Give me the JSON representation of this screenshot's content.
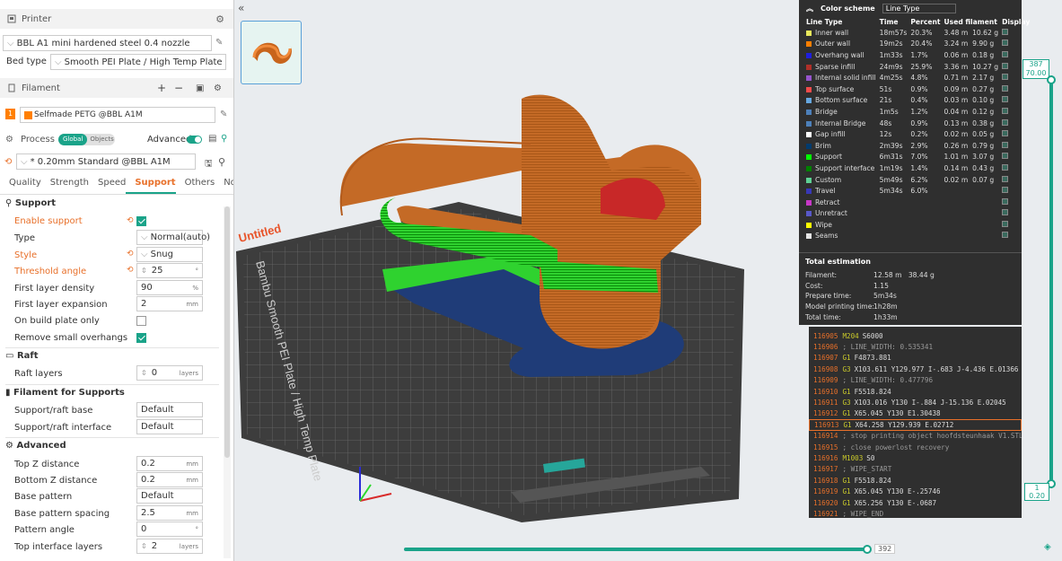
{
  "printer": {
    "header": "Printer",
    "model": "BBL A1 mini hardened steel 0.4 nozzle",
    "bed_label": "Bed type",
    "bed_value": "Smooth PEI Plate / High Temp Plate"
  },
  "filament": {
    "header": "Filament",
    "index": "1",
    "name": "Selfmade PETG @BBL A1M"
  },
  "process": {
    "header": "Process",
    "global_tab": "Global",
    "objects_tab": "Objects",
    "advanced_label": "Advanced",
    "preset": "* 0.20mm Standard @BBL A1M"
  },
  "tabs": [
    "Quality",
    "Strength",
    "Speed",
    "Support",
    "Others",
    "Notes"
  ],
  "support": {
    "group": "Support",
    "enable": "Enable support",
    "type_label": "Type",
    "type_val": "Normal(auto)",
    "style_label": "Style",
    "style_val": "Snug",
    "threshold_label": "Threshold angle",
    "threshold_val": "25",
    "threshold_unit": "°",
    "fld_label": "First layer density",
    "fld_val": "90",
    "fld_unit": "%",
    "fle_label": "First layer expansion",
    "fle_val": "2",
    "fle_unit": "mm",
    "obp_label": "On build plate only",
    "rso_label": "Remove small overhangs"
  },
  "raft": {
    "group": "Raft",
    "layers_label": "Raft layers",
    "layers_val": "0",
    "layers_unit": "layers"
  },
  "fil_support": {
    "group": "Filament for Supports",
    "base_label": "Support/raft base",
    "base_val": "Default",
    "iface_label": "Support/raft interface",
    "iface_val": "Default"
  },
  "advanced": {
    "group": "Advanced",
    "topz_label": "Top Z distance",
    "topz_val": "0.2",
    "botz_label": "Bottom Z distance",
    "botz_val": "0.2",
    "bp_label": "Base pattern",
    "bp_val": "Default",
    "bps_label": "Base pattern spacing",
    "bps_val": "2.5",
    "pa_label": "Pattern angle",
    "pa_val": "0",
    "til_label": "Top interface layers",
    "til_val": "2",
    "mm": "mm",
    "deg": "°",
    "layers": "layers"
  },
  "plate": {
    "name": "Untitled",
    "bed_text": "Bambu Smooth PEI Plate / High Temp Plate"
  },
  "legend": {
    "title": "Color scheme",
    "scheme": "Line Type",
    "cols": [
      "Line Type",
      "Time",
      "Percent",
      "Used filament",
      "Display"
    ],
    "rows": [
      {
        "name": "Inner wall",
        "color": "#e8e85c",
        "time": "18m57s",
        "pct": "20.3%",
        "len": "3.48 m",
        "g": "10.62 g"
      },
      {
        "name": "Outer wall",
        "color": "#ff7f00",
        "time": "19m2s",
        "pct": "20.4%",
        "len": "3.24 m",
        "g": "9.90 g"
      },
      {
        "name": "Overhang wall",
        "color": "#1f1fdf",
        "time": "1m33s",
        "pct": "1.7%",
        "len": "0.06 m",
        "g": "0.18 g"
      },
      {
        "name": "Sparse infill",
        "color": "#b03029",
        "time": "24m9s",
        "pct": "25.9%",
        "len": "3.36 m",
        "g": "10.27 g"
      },
      {
        "name": "Internal solid infill",
        "color": "#9654cc",
        "time": "4m25s",
        "pct": "4.8%",
        "len": "0.71 m",
        "g": "2.17 g"
      },
      {
        "name": "Top surface",
        "color": "#f04b4b",
        "time": "51s",
        "pct": "0.9%",
        "len": "0.09 m",
        "g": "0.27 g"
      },
      {
        "name": "Bottom surface",
        "color": "#66a8e0",
        "time": "21s",
        "pct": "0.4%",
        "len": "0.03 m",
        "g": "0.10 g"
      },
      {
        "name": "Bridge",
        "color": "#4d80ba",
        "time": "1m5s",
        "pct": "1.2%",
        "len": "0.04 m",
        "g": "0.12 g"
      },
      {
        "name": "Internal Bridge",
        "color": "#4d80ba",
        "time": "48s",
        "pct": "0.9%",
        "len": "0.13 m",
        "g": "0.38 g"
      },
      {
        "name": "Gap infill",
        "color": "#ffffff",
        "time": "12s",
        "pct": "0.2%",
        "len": "0.02 m",
        "g": "0.05 g"
      },
      {
        "name": "Brim",
        "color": "#003b6e",
        "time": "2m39s",
        "pct": "2.9%",
        "len": "0.26 m",
        "g": "0.79 g"
      },
      {
        "name": "Support",
        "color": "#00ff00",
        "time": "6m31s",
        "pct": "7.0%",
        "len": "1.01 m",
        "g": "3.07 g"
      },
      {
        "name": "Support interface",
        "color": "#008000",
        "time": "1m19s",
        "pct": "1.4%",
        "len": "0.14 m",
        "g": "0.43 g"
      },
      {
        "name": "Custom",
        "color": "#5ed194",
        "time": "5m49s",
        "pct": "6.2%",
        "len": "0.02 m",
        "g": "0.07 g"
      },
      {
        "name": "Travel",
        "color": "#3838b8",
        "time": "5m34s",
        "pct": "6.0%",
        "len": "",
        "g": ""
      },
      {
        "name": "Retract",
        "color": "#c838c8",
        "time": "",
        "pct": "",
        "len": "",
        "g": ""
      },
      {
        "name": "Unretract",
        "color": "#5858c8",
        "time": "",
        "pct": "",
        "len": "",
        "g": ""
      },
      {
        "name": "Wipe",
        "color": "#ffff00",
        "time": "",
        "pct": "",
        "len": "",
        "g": ""
      },
      {
        "name": "Seams",
        "color": "#e6e6e6",
        "time": "",
        "pct": "",
        "len": "",
        "g": ""
      }
    ],
    "total": {
      "title": "Total estimation",
      "filament_label": "Filament:",
      "filament_len": "12.58 m",
      "filament_g": "38.44 g",
      "cost_label": "Cost:",
      "cost": "1.15",
      "prep_label": "Prepare time:",
      "prep": "5m34s",
      "model_label": "Model printing time:",
      "model": "1h28m",
      "total_label": "Total time:",
      "total": "1h33m"
    }
  },
  "gcode": [
    {
      "n": "116905",
      "c": "M204",
      "a": "S6000"
    },
    {
      "n": "116906",
      "c": "",
      "a": "; LINE_WIDTH: 0.535341"
    },
    {
      "n": "116907",
      "c": "G1",
      "a": "F4873.881"
    },
    {
      "n": "116908",
      "c": "G3",
      "a": "X103.611 Y129.977 I-.683 J-4.436 E.01366"
    },
    {
      "n": "116909",
      "c": "",
      "a": "; LINE_WIDTH: 0.477796"
    },
    {
      "n": "116910",
      "c": "G1",
      "a": "F5518.824"
    },
    {
      "n": "116911",
      "c": "G3",
      "a": "X103.016 Y130 I-.884 J-15.136 E.02045"
    },
    {
      "n": "116912",
      "c": "G1",
      "a": "X65.045 Y130 E1.30438"
    },
    {
      "n": "116913",
      "c": "G1",
      "a": "X64.258 Y129.939 E.02712"
    },
    {
      "n": "116914",
      "c": "",
      "a": "; stop printing object hoofdsteunhaak V1.STL id:0 co..."
    },
    {
      "n": "116915",
      "c": "",
      "a": "; close powerlost recovery"
    },
    {
      "n": "116916",
      "c": "M1003",
      "a": "S0"
    },
    {
      "n": "116917",
      "c": "",
      "a": "; WIPE_START"
    },
    {
      "n": "116918",
      "c": "G1",
      "a": "F5518.824"
    },
    {
      "n": "116919",
      "c": "G1",
      "a": "X65.045 Y130 E-.25746"
    },
    {
      "n": "116920",
      "c": "G1",
      "a": "X65.256 Y130 E-.0687"
    },
    {
      "n": "116921",
      "c": "",
      "a": "; WIPE_END"
    }
  ],
  "layer_slider": {
    "top_layer": "387",
    "top_height": "70.00",
    "bottom_layer": "1",
    "bottom_height": "0.20"
  },
  "move_slider": {
    "value": "392"
  }
}
